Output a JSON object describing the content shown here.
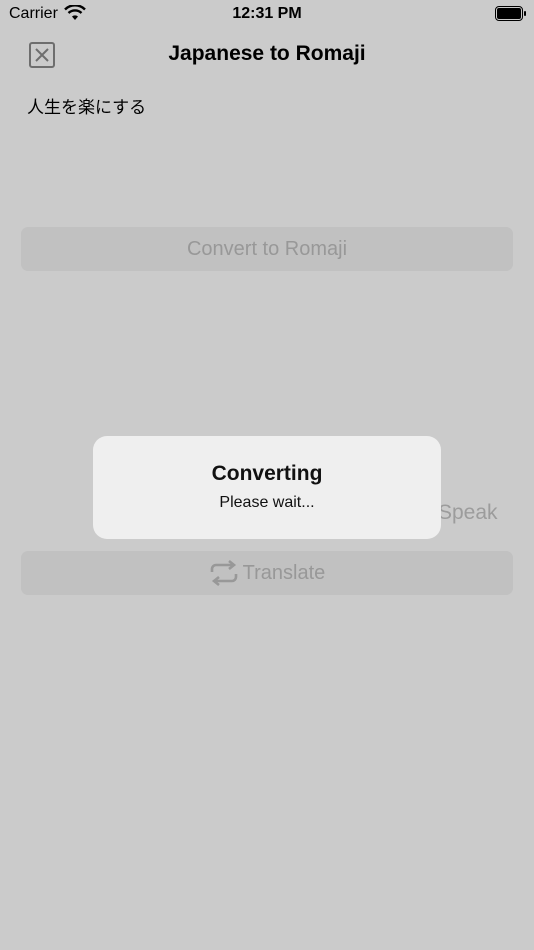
{
  "status_bar": {
    "carrier": "Carrier",
    "time": "12:31 PM"
  },
  "nav": {
    "title": "Japanese to Romaji"
  },
  "input": {
    "text": "人生を楽にする"
  },
  "buttons": {
    "convert": "Convert to Romaji",
    "translate": "Translate",
    "speak": "Speak"
  },
  "hud": {
    "title": "Converting",
    "message": "Please wait..."
  },
  "icons": {
    "close": "close-icon",
    "translate": "repeat-arrows-icon",
    "wifi": "wifi-icon",
    "battery": "battery-icon"
  },
  "colors": {
    "overlay_background": "#cbcbcb",
    "hud_background": "#efefef",
    "disabled_text": "#989898"
  }
}
